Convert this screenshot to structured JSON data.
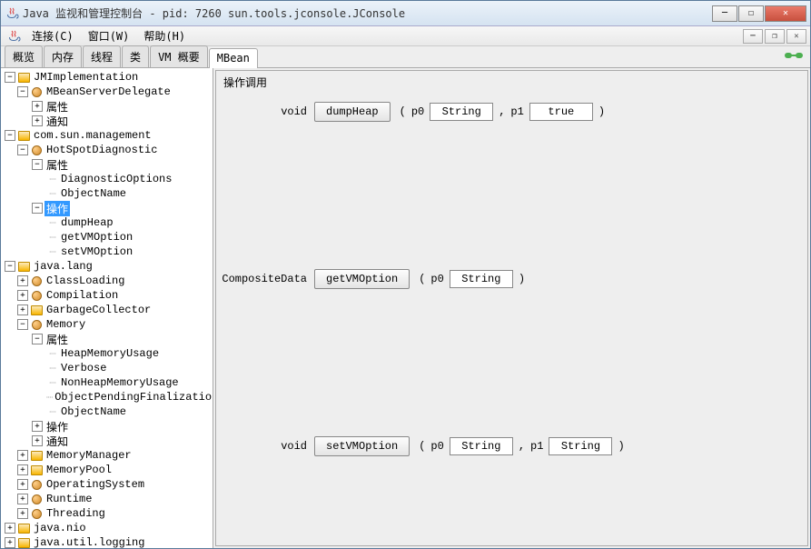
{
  "window": {
    "title": "Java 监视和管理控制台 - pid: 7260 sun.tools.jconsole.JConsole"
  },
  "menu": {
    "connect": "连接(C)",
    "window": "窗口(W)",
    "help": "帮助(H)"
  },
  "tabs": {
    "overview": "概览",
    "memory": "内存",
    "threads": "线程",
    "classes": "类",
    "vm": "VM 概要",
    "mbean": "MBean"
  },
  "tree": {
    "jmimpl": "JMImplementation",
    "mbeanserverdelegate": "MBeanServerDelegate",
    "attributes": "属性",
    "notifications": "通知",
    "comsun": "com.sun.management",
    "hotspot": "HotSpotDiagnostic",
    "diagnosticoptions": "DiagnosticOptions",
    "objectname": "ObjectName",
    "operations": "操作",
    "dumpheap": "dumpHeap",
    "getvmoption": "getVMOption",
    "setvmoption": "setVMOption",
    "javalang": "java.lang",
    "classloading": "ClassLoading",
    "compilation": "Compilation",
    "gc": "GarbageCollector",
    "memory_node": "Memory",
    "heapmemoryusage": "HeapMemoryUsage",
    "verbose": "Verbose",
    "nonheapmemoryusage": "NonHeapMemoryUsage",
    "objectpendingfinalization": "ObjectPendingFinalization",
    "memorymanager": "MemoryManager",
    "memorypool": "MemoryPool",
    "operatingsystem": "OperatingSystem",
    "runtime": "Runtime",
    "threading": "Threading",
    "javanio": "java.nio",
    "javautillogging": "java.util.logging"
  },
  "panel": {
    "title": "操作调用",
    "ops": [
      {
        "return": "void",
        "name": "dumpHeap",
        "params": [
          {
            "label": "p0",
            "value": "String"
          },
          {
            "label": "p1",
            "value": "true"
          }
        ]
      },
      {
        "return": "CompositeData",
        "name": "getVMOption",
        "params": [
          {
            "label": "p0",
            "value": "String"
          }
        ]
      },
      {
        "return": "void",
        "name": "setVMOption",
        "params": [
          {
            "label": "p0",
            "value": "String"
          },
          {
            "label": "p1",
            "value": "String"
          }
        ]
      }
    ]
  }
}
